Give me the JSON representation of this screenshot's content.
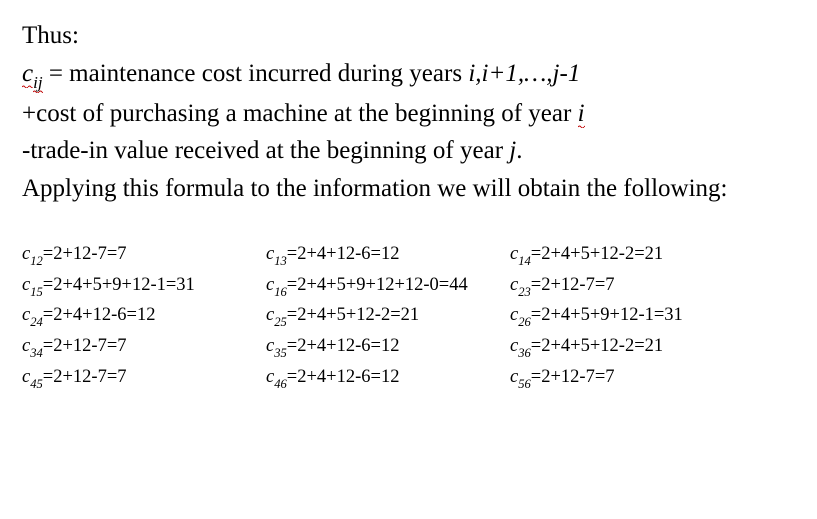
{
  "lines": {
    "l1": "Thus:",
    "l2a": "c",
    "l2a_sub": "ij",
    "l2b": " = maintenance cost incurred during years ",
    "l2c": "i,i+1,…,j-1",
    "l3a": "+cost of purchasing a machine at the beginning of year ",
    "l3b": "i",
    "l4a": "-trade-in value received at the beginning of year ",
    "l4b": "j",
    "l4c": ".",
    "l5": "Applying this formula to the information we will obtain the following:"
  },
  "grid": [
    [
      {
        "sub": "12",
        "rhs": "=2+12-7=7"
      },
      {
        "sub": "13",
        "rhs": "=2+4+12-6=12"
      },
      {
        "sub": "14",
        "rhs": "=2+4+5+12-2=21"
      }
    ],
    [
      {
        "sub": "15",
        "rhs": "=2+4+5+9+12-1=31"
      },
      {
        "sub": "16",
        "rhs": "=2+4+5+9+12+12-0=44"
      },
      {
        "sub": "23",
        "rhs": "=2+12-7=7"
      }
    ],
    [
      {
        "sub": "24",
        "rhs": "=2+4+12-6=12"
      },
      {
        "sub": "25",
        "rhs": "=2+4+5+12-2=21"
      },
      {
        "sub": "26",
        "rhs": "=2+4+5+9+12-1=31"
      }
    ],
    [
      {
        "sub": "34",
        "rhs": "=2+12-7=7"
      },
      {
        "sub": "35",
        "rhs": "=2+4+12-6=12"
      },
      {
        "sub": "36",
        "rhs": "=2+4+5+12-2=21"
      }
    ],
    [
      {
        "sub": "45",
        "rhs": "=2+12-7=7"
      },
      {
        "sub": "46",
        "rhs": "=2+4+12-6=12"
      },
      {
        "sub": "56",
        "rhs": "=2+12-7=7"
      }
    ]
  ]
}
